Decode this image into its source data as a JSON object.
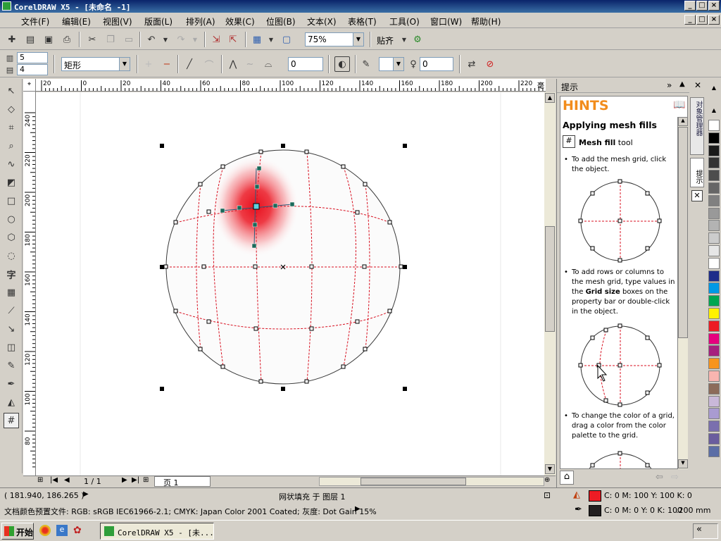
{
  "window": {
    "title": "CorelDRAW X5 - [未命名 -1]",
    "min": "_",
    "max": "□",
    "close": "×"
  },
  "menu": [
    "文件(F)",
    "编辑(E)",
    "视图(V)",
    "版面(L)",
    "排列(A)",
    "效果(C)",
    "位图(B)",
    "文本(X)",
    "表格(T)",
    "工具(O)",
    "窗口(W)",
    "帮助(H)"
  ],
  "toolbar": {
    "zoom": "75%",
    "snap_label": "贴齐"
  },
  "property_bar": {
    "grid_columns": "5",
    "grid_rows": "4",
    "selection_mode": "矩形",
    "smoothness": "0",
    "transparency": "0"
  },
  "rulers": {
    "h_ticks": [
      "20",
      "0",
      "20",
      "40",
      "60",
      "80",
      "100",
      "120",
      "140",
      "160",
      "180",
      "200",
      "220"
    ],
    "h_unit": "毫米",
    "v_ticks": [
      "240",
      "220",
      "200",
      "180",
      "160",
      "140",
      "120",
      "100",
      "80"
    ]
  },
  "page_nav": {
    "counter": "1 / 1",
    "tab": "页 1"
  },
  "docker": {
    "title": "提示",
    "hints_header": "HINTS",
    "heading": "Applying mesh fills",
    "tool_name": "Mesh fill",
    "tool_suffix": " tool",
    "bullet1": "To add the mesh grid, click the object.",
    "bullet2_a": "To add rows or columns to the mesh grid, type values in the ",
    "bullet2_bold": "Grid size",
    "bullet2_b": " boxes on the property bar or double-click in the object.",
    "bullet3": "To change the color of a grid, drag a color from the color palette to the grid."
  },
  "vertical_tabs": [
    "对象管理器",
    "提示"
  ],
  "palette_colors": [
    "#ffffff",
    "#000000",
    "#1a1a1a",
    "#333333",
    "#4d4d4d",
    "#666666",
    "#808080",
    "#999999",
    "#b3b3b3",
    "#cccccc",
    "#e6e6e6",
    "#ffffff",
    "#1f2d8a",
    "#0099e6",
    "#00a651",
    "#fff200",
    "#ed1c24",
    "#e6007e",
    "#a6207e",
    "#f7941d",
    "#f9b5b0",
    "#8c6b5a",
    "#c9b8d9",
    "#a99bd1",
    "#7a6fae",
    "#6a5d9e",
    "#5c6ea6"
  ],
  "status": {
    "coords": "( 181.940, 186.265 )",
    "object_info": "网状填充 于 图层 1",
    "fill_text": "C: 0 M: 100 Y: 100 K: 0",
    "fill_color": "#ed1c24",
    "outline_text": "C: 0 M: 0 Y: 0 K: 100",
    "outline_width": ".200 mm",
    "outline_color": "#231f20",
    "profile": "文档颜色预置文件: RGB: sRGB IEC61966-2.1; CMYK: Japan Color 2001 Coated; 灰度: Dot Gain 15%"
  },
  "taskbar": {
    "start": "开始",
    "app": "CorelDRAW X5 - [未...",
    "tray": "«"
  }
}
